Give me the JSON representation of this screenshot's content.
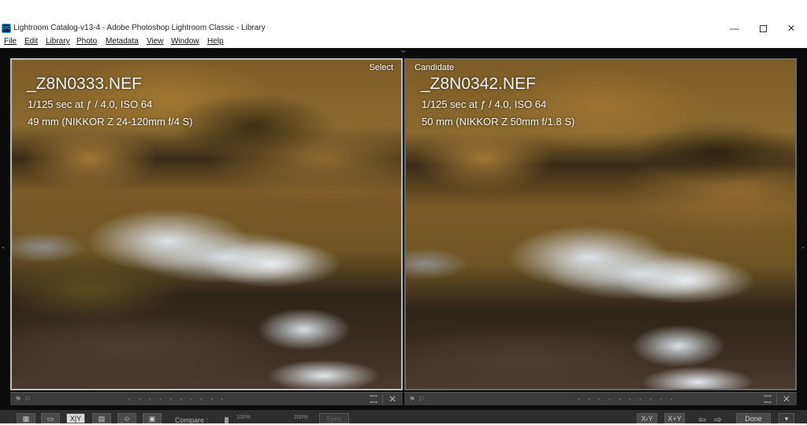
{
  "window": {
    "app_icon_text": "LrC",
    "title": "Lightroom Catalog-v13-4 - Adobe Photoshop Lightroom Classic - Library",
    "minimize": "—",
    "close": "✕"
  },
  "menu": [
    {
      "label": "File"
    },
    {
      "label": "Edit"
    },
    {
      "label": "Library"
    },
    {
      "label": "Photo"
    },
    {
      "label": "Metadata"
    },
    {
      "label": "View"
    },
    {
      "label": "Window"
    },
    {
      "label": "Help"
    }
  ],
  "compare": {
    "select": {
      "role": "Select",
      "filename": "_Z8N0333.NEF",
      "exposure": "1/125 sec at ƒ / 4.0, ISO 64",
      "lens": "49 mm (NIKKOR Z 24-120mm f/4 S)"
    },
    "candidate": {
      "role": "Candidate",
      "filename": "_Z8N0342.NEF",
      "exposure": "1/125 sec at ƒ / 4.0, ISO 64",
      "lens": "50 mm (NIKKOR Z 50mm f/1.8 S)"
    }
  },
  "panel_footer": {
    "flag_icon": "flag-icon",
    "close": "✕",
    "dots": "• • • • • • • • • •"
  },
  "toolbar": {
    "grid_view": "grid-view-icon",
    "loupe_view": "loupe-view-icon",
    "compare_view": "X|Y",
    "survey_view": "survey-view-icon",
    "people_view": "people-view-icon",
    "slideshow": "slideshow-icon",
    "compare_label": "Compare :",
    "zoom_min": "100%",
    "zoom_max": "200%",
    "sync": "Sync",
    "swap": "X‹Y",
    "make_select": "X+Y",
    "prev": "⇦",
    "next": "⇨",
    "done": "Done",
    "menu": "▾"
  }
}
